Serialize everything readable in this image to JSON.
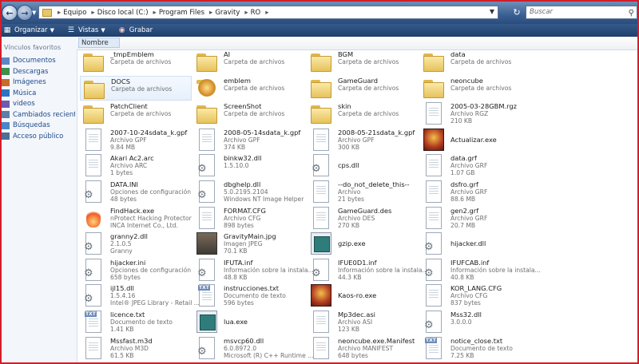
{
  "address": {
    "crumbs": [
      "Equipo",
      "Disco local (C:)",
      "Program Files",
      "Gravity",
      "RO"
    ],
    "search_placeholder": "Buscar"
  },
  "toolbar": {
    "organize": "Organizar",
    "views": "Vistas",
    "burn": "Grabar"
  },
  "sidebar": {
    "title": "Vínculos favoritos",
    "items": [
      "Documentos",
      "Descargas",
      "Imágenes",
      "Música",
      "videos",
      "Cambiados recient...",
      "Búsquedas",
      "Acceso público"
    ]
  },
  "column_header": "Nombre",
  "files": [
    {
      "name": "_tmpEmblem",
      "type": "Carpeta de archivos",
      "size": "",
      "icon": "folder-icon"
    },
    {
      "name": "AI",
      "type": "Carpeta de archivos",
      "size": "",
      "icon": "folder-icon"
    },
    {
      "name": "BGM",
      "type": "Carpeta de archivos",
      "size": "",
      "icon": "folder-icon"
    },
    {
      "name": "data",
      "type": "Carpeta de archivos",
      "size": "",
      "icon": "folder-icon"
    },
    {
      "name": "DOCS",
      "type": "Carpeta de archivos",
      "size": "",
      "icon": "folder-icon"
    },
    {
      "name": "emblem",
      "type": "Carpeta de archivos",
      "size": "",
      "icon": "folder-icon"
    },
    {
      "name": "GameGuard",
      "type": "Carpeta de archivos",
      "size": "",
      "icon": "folder-icon"
    },
    {
      "name": "neoncube",
      "type": "Carpeta de archivos",
      "size": "",
      "icon": "folder-icon"
    },
    {
      "name": "PatchClient",
      "type": "Carpeta de archivos",
      "size": "",
      "icon": "folder-icon"
    },
    {
      "name": "ScreenShot",
      "type": "Carpeta de archivos",
      "size": "",
      "icon": "folder-icon"
    },
    {
      "name": "skin",
      "type": "Carpeta de archivos",
      "size": "",
      "icon": "folder-icon"
    },
    {
      "name": "2005-03-28GBM.rgz",
      "type": "Archivo RGZ",
      "size": "210 KB",
      "icon": "document-icon"
    },
    {
      "name": "2007-10-24sdata_k.gpf",
      "type": "Archivo GPF",
      "size": "9.84 MB",
      "icon": "document-icon"
    },
    {
      "name": "2008-05-14sdata_k.gpf",
      "type": "Archivo GPF",
      "size": "374 KB",
      "icon": "document-icon"
    },
    {
      "name": "2008-05-21sdata_k.gpf",
      "type": "Archivo GPF",
      "size": "300 KB",
      "icon": "document-icon"
    },
    {
      "name": "Actualizar.exe",
      "type": "",
      "size": "",
      "icon": "red-app-icon"
    },
    {
      "name": "Akari Ac2.arc",
      "type": "Archivo ARC",
      "size": "1 bytes",
      "icon": "document-icon"
    },
    {
      "name": "binkw32.dll",
      "type": "1.5.10.0",
      "size": "",
      "icon": "config-icon"
    },
    {
      "name": "cps.dll",
      "type": "",
      "size": "",
      "icon": "config-icon"
    },
    {
      "name": "data.grf",
      "type": "Archivo GRF",
      "size": "1.07 GB",
      "icon": "document-icon"
    },
    {
      "name": "DATA.INI",
      "type": "Opciones de configuración",
      "size": "48 bytes",
      "icon": "config-icon"
    },
    {
      "name": "dbghelp.dll",
      "type": "5.0.2195.2104",
      "size": "Windows NT Image Helper",
      "icon": "config-icon"
    },
    {
      "name": "--do_not_delete_this--",
      "type": "Archivo",
      "size": "21 bytes",
      "icon": "document-icon"
    },
    {
      "name": "dsfro.grf",
      "type": "Archivo GRF",
      "size": "88.6 MB",
      "icon": "document-icon"
    },
    {
      "name": "FindHack.exe",
      "type": "nProtect Hacking Protector",
      "size": "INCA Internet Co., Ltd.",
      "icon": "flame-icon"
    },
    {
      "name": "FORMAT.CFG",
      "type": "Archivo CFG",
      "size": "898 bytes",
      "icon": "document-icon"
    },
    {
      "name": "GameGuard.des",
      "type": "Archivo DES",
      "size": "270 KB",
      "icon": "document-icon"
    },
    {
      "name": "gen2.grf",
      "type": "Archivo GRF",
      "size": "20.7 MB",
      "icon": "document-icon"
    },
    {
      "name": "granny2.dll",
      "type": "2.1.0.5",
      "size": "Granny",
      "icon": "config-icon"
    },
    {
      "name": "GravityMain.jpg",
      "type": "Imagen JPEG",
      "size": "70.1 KB",
      "icon": "image-icon"
    },
    {
      "name": "gzip.exe",
      "type": "",
      "size": "",
      "icon": "app-icon"
    },
    {
      "name": "hijacker.dll",
      "type": "",
      "size": "",
      "icon": "config-icon"
    },
    {
      "name": "hijacker.ini",
      "type": "Opciones de configuración",
      "size": "658 bytes",
      "icon": "config-icon"
    },
    {
      "name": "IFUTA.inf",
      "type": "Información sobre la instala...",
      "size": "48.8 KB",
      "icon": "config-icon"
    },
    {
      "name": "IFUE0D1.inf",
      "type": "Información sobre la instala...",
      "size": "44.3 KB",
      "icon": "config-icon"
    },
    {
      "name": "IFUFCAB.inf",
      "type": "Información sobre la instala...",
      "size": "40.8 KB",
      "icon": "config-icon"
    },
    {
      "name": "ijl15.dll",
      "type": "1.5.4.16",
      "size": "Intel® JPEG Library - Retail ...",
      "icon": "config-icon"
    },
    {
      "name": "instrucciones.txt",
      "type": "Documento de texto",
      "size": "596 bytes",
      "icon": "text-file-icon"
    },
    {
      "name": "Kaos-ro.exe",
      "type": "",
      "size": "",
      "icon": "red-app-icon"
    },
    {
      "name": "KOR_LANG.CFG",
      "type": "Archivo CFG",
      "size": "837 bytes",
      "icon": "document-icon"
    },
    {
      "name": "licence.txt",
      "type": "Documento de texto",
      "size": "1.41 KB",
      "icon": "text-file-icon"
    },
    {
      "name": "lua.exe",
      "type": "",
      "size": "",
      "icon": "app-icon"
    },
    {
      "name": "Mp3dec.asi",
      "type": "Archivo ASI",
      "size": "123 KB",
      "icon": "document-icon"
    },
    {
      "name": "Mss32.dll",
      "type": "3.0.0.0",
      "size": "",
      "icon": "config-icon"
    },
    {
      "name": "Mssfast.m3d",
      "type": "Archivo M3D",
      "size": "61.5 KB",
      "icon": "document-icon"
    },
    {
      "name": "msvcp60.dll",
      "type": "6.0.8972.0",
      "size": "Microsoft (R) C++ Runtime ...",
      "icon": "config-icon"
    },
    {
      "name": "neoncube.exe.Manifest",
      "type": "Archivo MANIFEST",
      "size": "648 bytes",
      "icon": "document-icon"
    },
    {
      "name": "notice_close.txt",
      "type": "Documento de texto",
      "size": "7.25 KB",
      "icon": "text-file-icon"
    }
  ]
}
